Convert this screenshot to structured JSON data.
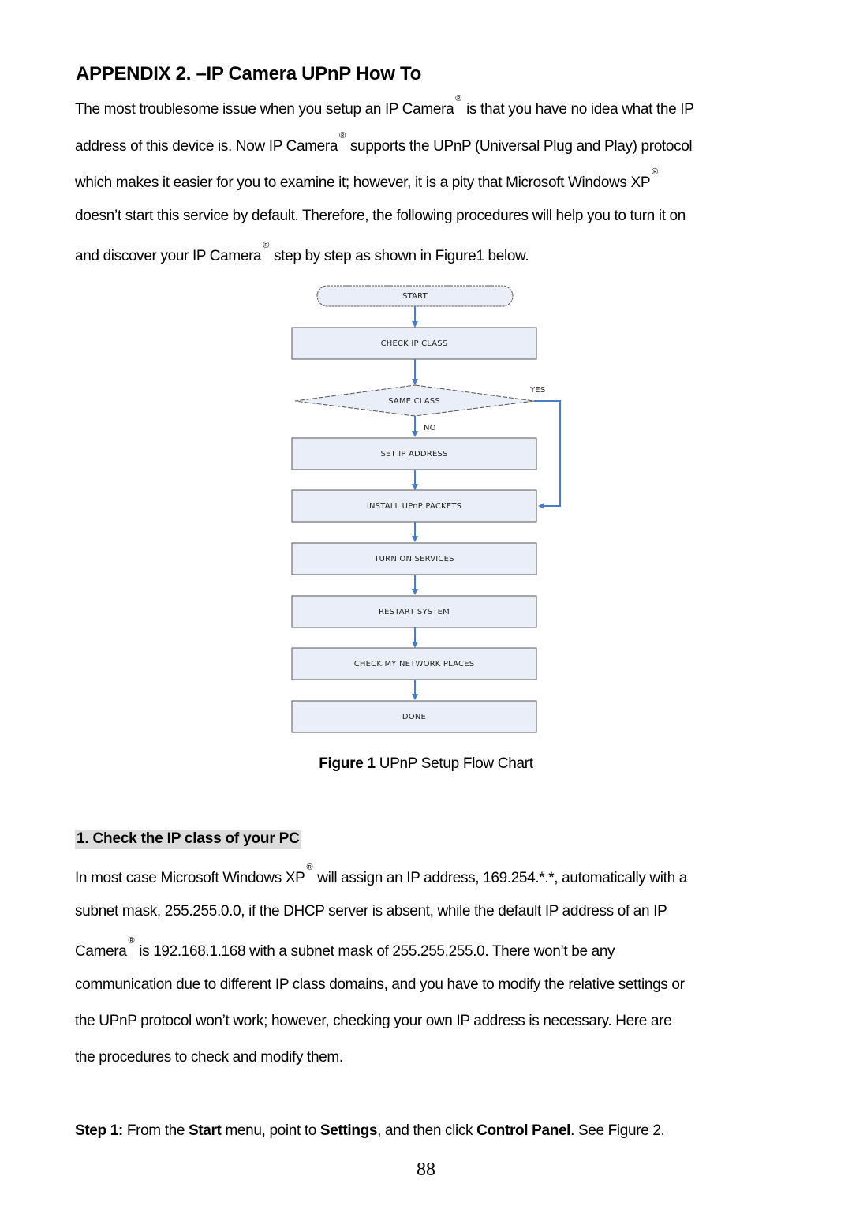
{
  "heading": "APPENDIX 2. –IP Camera UPnP How To",
  "intro": {
    "l1a": "The most troublesome issue when you setup an IP Camera",
    "l1b": "is that you have no idea what the IP",
    "l2a": "address of this device is. Now IP Camera",
    "l2b": "supports the UPnP (Universal Plug and Play) protocol",
    "l3a": "which makes it easier for you to examine it; however, it is a pity that Microsoft Windows XP",
    "l4": "doesn’t start this service by default. Therefore, the following procedures will help you to turn it on",
    "l5a": "and discover your IP Camera",
    "l5b": "step by step as shown in Figure1 below."
  },
  "reg": "®",
  "flowchart": {
    "start": "START",
    "check_ip_class": "CHECK IP CLASS",
    "decision": "SAME CLASS",
    "yes": "YES",
    "no": "NO",
    "set_ip": "SET IP ADDRESS",
    "install": "INSTALL UPnP PACKETS",
    "services": "TURN ON SERVICES",
    "restart": "RESTART SYSTEM",
    "network": "CHECK MY NETWORK PLACES",
    "done": "DONE",
    "colors": {
      "fill": "#eaeef8",
      "border": "#555555",
      "arrow": "#4a7cc7"
    }
  },
  "caption": {
    "label": "Figure 1",
    "text": " UPnP Setup Flow Chart"
  },
  "section_title": "1. Check the IP class of your PC",
  "body": {
    "l1a": "In most case Microsoft Windows XP",
    "l1b": "will assign an IP address, 169.254.*.*, automatically with a",
    "l2": "subnet mask, 255.255.0.0, if the DHCP server is absent, while the default IP address of an IP",
    "l3a": "Camera",
    "l3b": "is 192.168.1.168 with a subnet mask of 255.255.255.0. There won’t be any",
    "l4": "communication due to different IP class domains, and you have to modify the relative settings or",
    "l5": "the UPnP protocol won’t work; however, checking your own IP address is necessary. Here are",
    "l6": "the procedures to check and modify them."
  },
  "step1": {
    "label": "Step 1:",
    "t1": " From the ",
    "start": "Start",
    "t2": " menu, point to ",
    "settings": "Settings",
    "t3": ", and then click ",
    "control_panel": "Control Panel",
    "t4": ". See Figure 2."
  },
  "page_number": "88"
}
